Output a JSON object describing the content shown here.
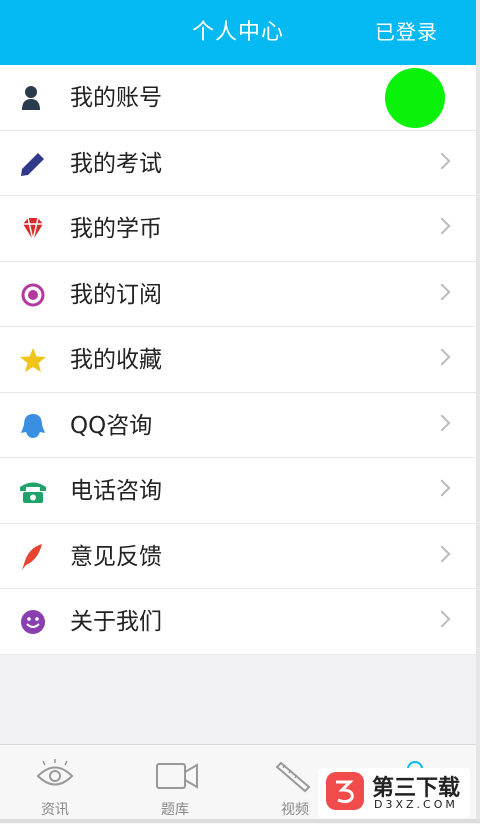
{
  "header": {
    "title": "个人中心",
    "status": "已登录"
  },
  "menu": {
    "items": [
      {
        "label": "我的账号",
        "icon": "user-icon"
      },
      {
        "label": "我的考试",
        "icon": "pencil-icon"
      },
      {
        "label": "我的学币",
        "icon": "diamond-icon"
      },
      {
        "label": "我的订阅",
        "icon": "target-icon"
      },
      {
        "label": "我的收藏",
        "icon": "star-icon"
      },
      {
        "label": "QQ咨询",
        "icon": "qq-penguin-icon"
      },
      {
        "label": "电话咨询",
        "icon": "telephone-icon"
      },
      {
        "label": "意见反馈",
        "icon": "feather-icon"
      },
      {
        "label": "关于我们",
        "icon": "smiley-icon"
      }
    ]
  },
  "avatar": {
    "color": "#0af20a"
  },
  "tabbar": {
    "tabs": [
      {
        "label": "资讯",
        "icon": "eye-icon"
      },
      {
        "label": "题库",
        "icon": "video-camera-icon"
      },
      {
        "label": "视频",
        "icon": "pencil-ruler-icon"
      },
      {
        "label": "",
        "icon": "person-icon"
      }
    ]
  },
  "watermark": {
    "title": "第三下载",
    "subtitle": "D3XZ.COM"
  },
  "colors": {
    "header": "#05b9f3",
    "avatar": "#0af20a",
    "watermark_logo": "#f24b4b"
  }
}
